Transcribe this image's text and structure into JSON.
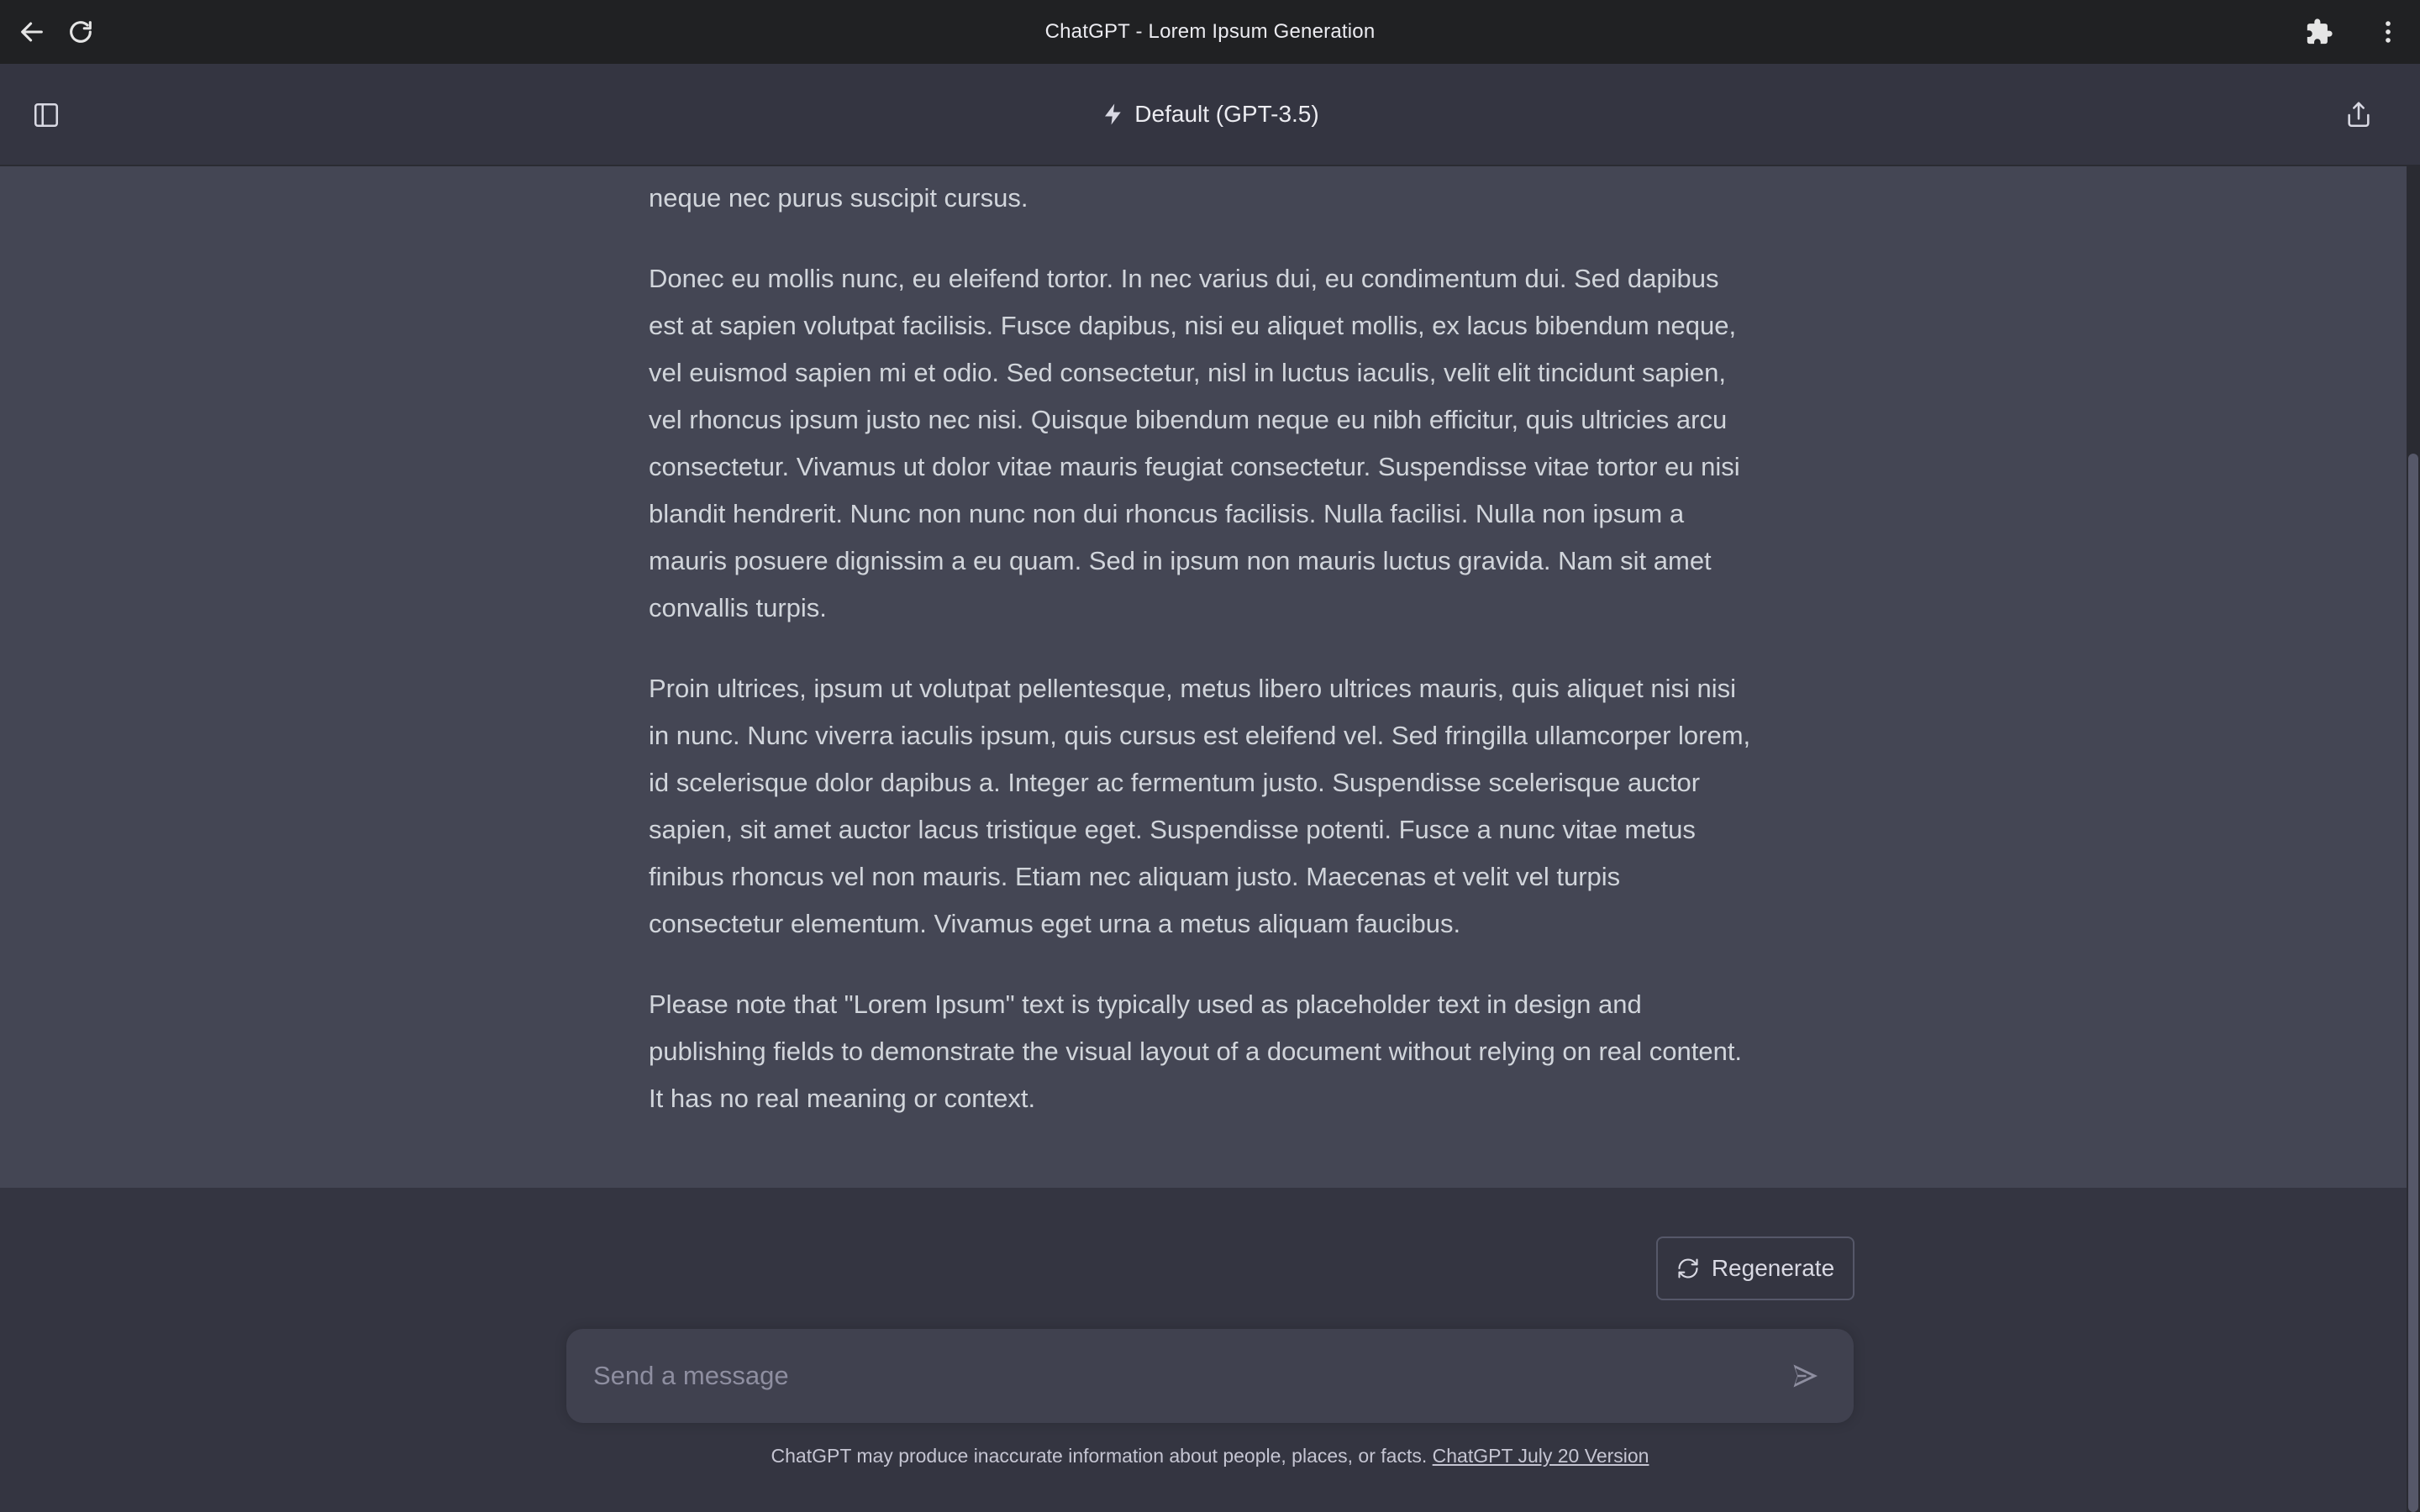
{
  "window": {
    "title": "ChatGPT - Lorem Ipsum Generation",
    "icons": [
      "back-arrow-icon",
      "reload-icon",
      "extensions-icon",
      "more-vertical-icon"
    ]
  },
  "header": {
    "model_label": "Default (GPT-3.5)",
    "icons": [
      "sidebar-toggle-icon",
      "lightning-icon",
      "share-icon"
    ]
  },
  "message": {
    "paragraphs": [
      "interdum. Sed tincidunt ipsum a quam bibendum, ac facilisis neque venenatis. Suspendisse in neque nec purus suscipit cursus.",
      "Donec eu mollis nunc, eu eleifend tortor. In nec varius dui, eu condimentum dui. Sed dapibus est at sapien volutpat facilisis. Fusce dapibus, nisi eu aliquet mollis, ex lacus bibendum neque, vel euismod sapien mi et odio. Sed consectetur, nisl in luctus iaculis, velit elit tincidunt sapien, vel rhoncus ipsum justo nec nisi. Quisque bibendum neque eu nibh efficitur, quis ultricies arcu consectetur. Vivamus ut dolor vitae mauris feugiat consectetur. Suspendisse vitae tortor eu nisi blandit hendrerit. Nunc non nunc non dui rhoncus facilisis. Nulla facilisi. Nulla non ipsum a mauris posuere dignissim a eu quam. Sed in ipsum non mauris luctus gravida. Nam sit amet convallis turpis.",
      "Proin ultrices, ipsum ut volutpat pellentesque, metus libero ultrices mauris, quis aliquet nisi nisi in nunc. Nunc viverra iaculis ipsum, quis cursus est eleifend vel. Sed fringilla ullamcorper lorem, id scelerisque dolor dapibus a. Integer ac fermentum justo. Suspendisse scelerisque auctor sapien, sit amet auctor lacus tristique eget. Suspendisse potenti. Fusce a nunc vitae metus finibus rhoncus vel non mauris. Etiam nec aliquam justo. Maecenas et velit vel turpis consectetur elementum. Vivamus eget urna a metus aliquam faucibus.",
      "Please note that \"Lorem Ipsum\" text is typically used as placeholder text in design and publishing fields to demonstrate the visual layout of a document without relying on real content. It has no real meaning or context."
    ]
  },
  "composer": {
    "regenerate_label": "Regenerate",
    "placeholder": "Send a message",
    "icons": [
      "regenerate-icon",
      "send-icon"
    ]
  },
  "footer": {
    "disclaimer": "ChatGPT may produce inaccurate information about people, places, or facts.",
    "version_link": "ChatGPT July 20 Version"
  },
  "colors": {
    "title_bar": "#202123",
    "background": "#343541",
    "assistant_message_bg": "#444654",
    "composer_bg": "#40414f",
    "text": "#d1d5db"
  }
}
